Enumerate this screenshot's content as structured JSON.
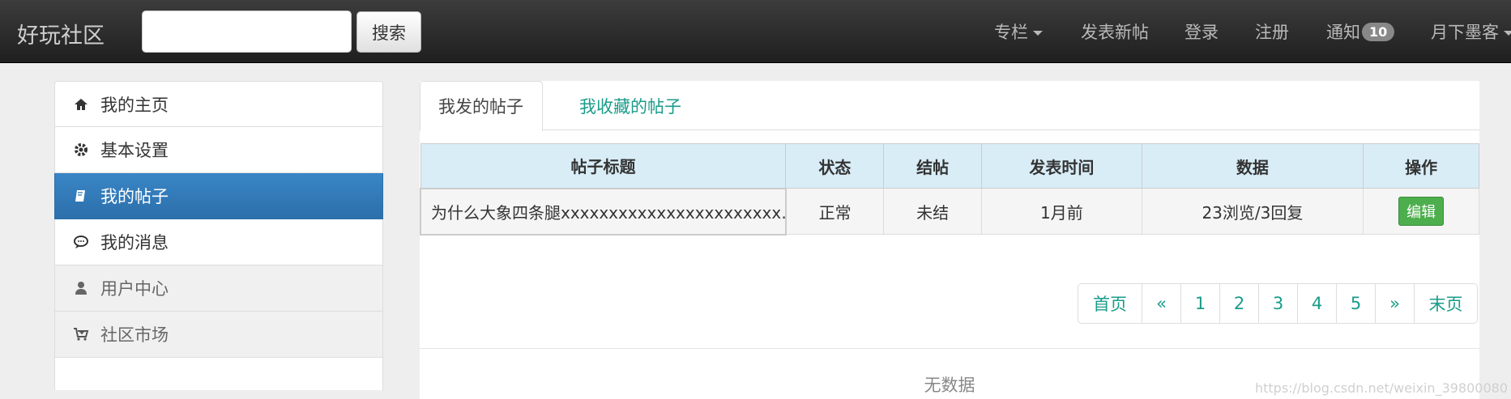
{
  "navbar": {
    "brand": "好玩社区",
    "search_placeholder": "",
    "search_button": "搜索",
    "items": {
      "column": "专栏",
      "new_post": "发表新帖",
      "login": "登录",
      "register": "注册",
      "notice": "通知",
      "notice_count": "10",
      "user": "月下墨客"
    }
  },
  "sidebar": {
    "items": [
      {
        "label": "我的主页",
        "icon": "home-icon"
      },
      {
        "label": "基本设置",
        "icon": "gear-icon"
      },
      {
        "label": "我的帖子",
        "icon": "book-icon"
      },
      {
        "label": "我的消息",
        "icon": "comment-icon"
      },
      {
        "label": "用户中心",
        "icon": "user-icon"
      },
      {
        "label": "社区市场",
        "icon": "cart-icon"
      }
    ],
    "active_index": 2
  },
  "tabs": {
    "my_posts": "我发的帖子",
    "my_favorites": "我收藏的帖子"
  },
  "table": {
    "headers": [
      "帖子标题",
      "状态",
      "结帖",
      "发表时间",
      "数据",
      "操作"
    ],
    "rows": [
      {
        "title": "为什么大象四条腿xxxxxxxxxxxxxxxxxxxxxxx…",
        "status": "正常",
        "closed": "未结",
        "time": "1月前",
        "stats": "23浏览/3回复",
        "action": "编辑"
      }
    ]
  },
  "pagination": {
    "first": "首页",
    "prev": "«",
    "pages": [
      "1",
      "2",
      "3",
      "4",
      "5"
    ],
    "next": "»",
    "last": "末页"
  },
  "empty_text": "无数据",
  "watermark": "https://blog.csdn.net/weixin_39800080",
  "colors": {
    "accent": "#1a9c8a",
    "active_sidebar": "#3079b8",
    "table_header": "#d9edf7",
    "edit_button": "#4cae4c"
  }
}
